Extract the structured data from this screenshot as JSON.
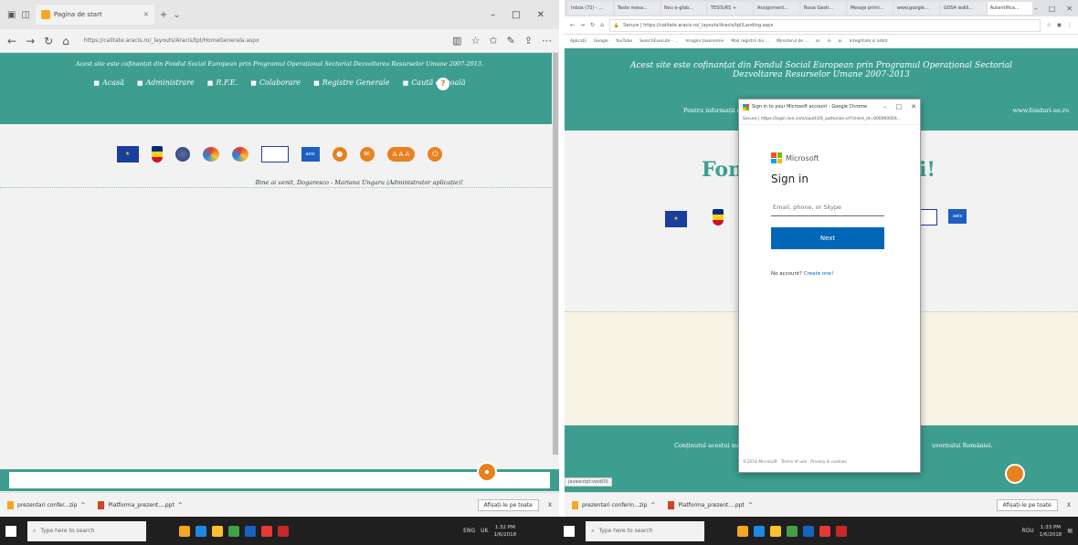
{
  "left": {
    "tab_title": "Pagina de start",
    "url": "https://calitate.aracis.ro/_layouts/Aracis/tpl/HomeGenerala.aspx",
    "header": {
      "tagline": "Acest site este cofinanțat din Fondul Social European prin Programul Operațional Sectorial Dezvoltarea Resurselor Umane 2007-2013.",
      "menu": [
        "Acasă",
        "Administrare",
        "R.F.E.",
        "Colaborare",
        "Registre Generale",
        "Caută o școală"
      ],
      "help_label": "?"
    },
    "aaa_label": "A A A",
    "welcome": "Bine ai venit, Dogaresco - Mariana Ungaru (Administrator aplicație)!",
    "downloads": [
      {
        "name": "prezentari confer...zip",
        "caret": "^"
      },
      {
        "name": "Platforma_prezent....ppt",
        "caret": "^"
      }
    ],
    "show_all": "Afișați-le pe toate",
    "close": "X"
  },
  "right": {
    "tabs": [
      "Inbox (72) - ...",
      "Teste mesa...",
      "Nou e-glob...",
      "TESIS/RS +",
      "Assignment...",
      "Noua Gesti...",
      "Mesaje primi...",
      "www.google...",
      "GOS4 iedili...",
      "Autentifica..."
    ],
    "address": "Secure | https://calitate.aracis.ro/_layouts/Aracis/tpl/Landing.aspx",
    "bookmarks": [
      "Aplicații",
      "Google",
      "YouTube",
      "SearchExecute - ...",
      "Imagini taxonomie",
      "Mail registrii din ...",
      "Ministerul de ...",
      "ar",
      "in",
      "ai",
      "Integritate și arbitr"
    ],
    "header_line1": "Acest site este cofinanțat din Fondul Social European prin Programul Operațional Sectorial",
    "header_line2": "Dezvoltarea Resurselor Umane 2007-2013",
    "info_left": "Pentru informații detaliate",
    "info_right": "www.fonduri-ue.ro",
    "big_title_left": "Fond",
    "big_title_right": "ni!",
    "footer_left": "Conținutul acestui mate",
    "footer_right": "uvernului României.",
    "status": "javascript:void(0)",
    "downloads": [
      {
        "name": "prezentari conferin...zip",
        "caret": "^"
      },
      {
        "name": "Platforma_prezent....ppt",
        "caret": "^"
      }
    ],
    "show_all": "Afișați-le pe toate",
    "close": "X"
  },
  "signin": {
    "window_title": "Sign in to your Microsoft account - Google Chrome",
    "url": "Secure | https://login.live.com/oauth20_authorize.srf?client_id=000000004...",
    "brand": "Microsoft",
    "heading": "Sign in",
    "input_placeholder": "Email, phone, or Skype",
    "next_label": "Next",
    "no_account": "No account?",
    "create_one": "Create one!",
    "footer": [
      "©2018 Microsoft",
      "Terms of use",
      "Privacy & cookies"
    ]
  },
  "taskbar_left": {
    "search_placeholder": "Type here to search",
    "lang": "ENG",
    "region": "UK",
    "time": "1:32 PM",
    "date": "1/6/2018"
  },
  "taskbar_right": {
    "search_placeholder": "Type here to search",
    "lang": "ROU",
    "time": "1:33 PM",
    "date": "1/6/2018"
  },
  "colors": {
    "teal": "#3d9e8f",
    "orange": "#e8821f",
    "ms_blue": "#0067b8"
  }
}
